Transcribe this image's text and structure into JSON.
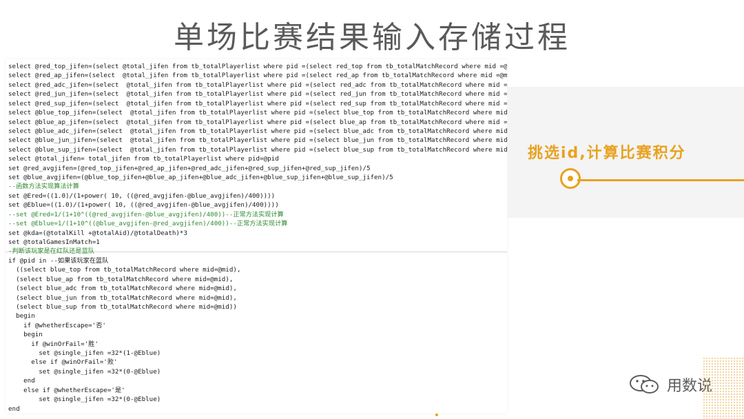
{
  "slide": {
    "title": "单场比赛结果输入存储过程",
    "caption": "挑选id,计算比赛积分",
    "watermark_text": "用数说",
    "accent_color": "#e8a21f"
  },
  "code": {
    "lines": [
      "select @red_top_jifen=(select @total_jifen from tb_totalPlayerlist where pid =(select red_top from tb_totalMatchRecord where mid =@mid))",
      "select @red_ap_jifen=(select  @total_jifen from tb_totalPlayerlist where pid =(select red_ap from tb_totalMatchRecord where mid =@mid))",
      "select @red_adc_jifen=(select  @total_jifen from tb_totalPlayerlist where pid =(select red_adc from tb_totalMatchRecord where mid =@mid))",
      "select @red_jun_jifen=(select  @total_jifen from tb_totalPlayerlist where pid =(select red_jun from tb_totalMatchRecord where mid =@mid))",
      "select @red_sup_jifen=(select  @total_jifen from tb_totalPlayerlist where pid =(select red_sup from tb_totalMatchRecord where mid =@mid))",
      "select @blue_top_jifen=(select  @total_jifen from tb_totalPlayerlist where pid =(select blue_top from tb_totalMatchRecord where mid =@mid))",
      "select @blue_ap_jifen=(select  @total_jifen from tb_totalPlayerlist where pid =(select blue_ap from tb_totalMatchRecord where mid =@mid))",
      "select @blue_adc_jifen=(select  @total_jifen from tb_totalPlayerlist where pid =(select blue_adc from tb_totalMatchRecord where mid =@mid))",
      "select @blue_jun_jifen=(select  @total_jifen from tb_totalPlayerlist where pid =(select blue_jun from tb_totalMatchRecord where mid =@mid))",
      "select @blue_sup_jifen=(select  @total_jifen from tb_totalPlayerlist where pid =(select blue_sup from tb_totalMatchRecord where mid =@mid))",
      "select @total_jifen= total_jifen from tb_totalPlayerlist where pid=@pid",
      "set @red_avgjifen=(@red_top_jifen+@red_ap_jifen+@red_adc_jifen+@red_sup_jifen+@red_sup_jifen)/5",
      "set @blue_avgjifen=(@blue_top_jifen+@blue_ap_jifen+@blue_adc_jifen+@blue_sup_jifen+@blue_sup_jifen)/5",
      "--函数方法实现算法计算",
      "set @Ered=((1.0)/(1+power( 10, ((@red_avgjifen-@blue_avgjifen)/400))))",
      "set @Eblue=((1.0)/(1+power( 10, ((@red_avgjifen-@blue_avgjifen)/400))))",
      "--set @Ered=1/(1+10^((@red_avgjifen-@blue_avgjifen)/400))--正常方法实现计算",
      "--set @Eblue=1/(1+10^((@blue_avgjifen-@red_avgjifen)/400))--正常方法实现计算",
      "set @kda=(@totalKill +@totalAid)/@totalDeath)*3",
      "set @totalGamesInMatch=1",
      "-判断该玩家是在红队还是蓝队",
      "if @pid in --如果该玩家在蓝队",
      "  ((select blue_top from tb_totalMatchRecord where mid=@mid),",
      "  (select blue_ap from tb_totalMatchRecord where mid=@mid),",
      "  (select blue_adc from tb_totalMatchRecord where mid=@mid),",
      "  (select blue_jun from tb_totalMatchRecord where mid=@mid),",
      "  (select blue_sup from tb_totalMatchRecord where mid=@mid))",
      "  begin",
      "    if @whetherEscape='否'",
      "    begin",
      "      if @winOrFail='胜'",
      "        set @single_jifen =32*(1-@Eblue)",
      "      else if @winOrFail='败'",
      "        set @single_jifen =32*(0-@Eblue)",
      "    end",
      "    else if @whetherEscape='是'",
      "        set @single_jifen =32*(0-@Eblue)",
      "end"
    ]
  }
}
